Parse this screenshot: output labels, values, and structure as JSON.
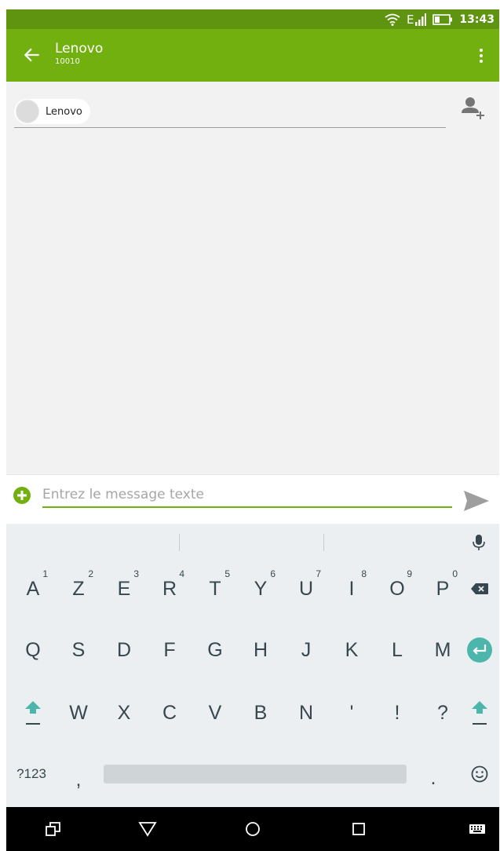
{
  "status_bar": {
    "network_label": "E",
    "time": "13:43",
    "icons": [
      "wifi-icon",
      "signal-icon",
      "battery-icon"
    ]
  },
  "toolbar": {
    "title": "Lenovo",
    "subtitle": "10010",
    "icons": [
      "back-arrow-icon",
      "more-vert-icon"
    ]
  },
  "recipient": {
    "chip_label": "Lenovo",
    "icons": [
      "contact-avatar-icon",
      "add-contact-icon"
    ]
  },
  "compose": {
    "placeholder": "Entrez le message texte",
    "value": "",
    "icons": [
      "add-circle-icon",
      "send-icon"
    ]
  },
  "keyboard": {
    "row1": [
      {
        "label": "A",
        "hint": "1"
      },
      {
        "label": "Z",
        "hint": "2"
      },
      {
        "label": "E",
        "hint": "3"
      },
      {
        "label": "R",
        "hint": "4"
      },
      {
        "label": "T",
        "hint": "5"
      },
      {
        "label": "Y",
        "hint": "6"
      },
      {
        "label": "U",
        "hint": "7"
      },
      {
        "label": "I",
        "hint": "8"
      },
      {
        "label": "O",
        "hint": "9"
      },
      {
        "label": "P",
        "hint": "0"
      }
    ],
    "row2": [
      "Q",
      "S",
      "D",
      "F",
      "G",
      "H",
      "J",
      "K",
      "L",
      "M"
    ],
    "row3": [
      "W",
      "X",
      "C",
      "V",
      "B",
      "N",
      "'",
      "!",
      "?"
    ],
    "symbols_label": "?123",
    "comma": ",",
    "period": ".",
    "icons": [
      "mic-icon",
      "backspace-icon",
      "enter-icon",
      "shift-icon",
      "emoji-icon"
    ],
    "accent_color": "#4db6ac"
  },
  "nav_bar": {
    "icons": [
      "recent-apps-icon",
      "back-triangle-icon",
      "home-circle-icon",
      "overview-square-icon",
      "keyboard-switch-icon"
    ]
  },
  "colors": {
    "toolbar": "#72b00f",
    "status_bar": "#5e9410"
  }
}
